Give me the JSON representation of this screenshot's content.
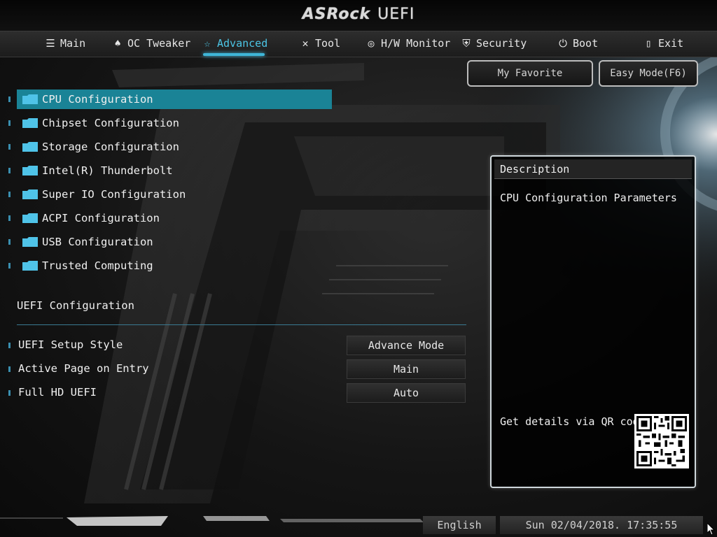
{
  "header": {
    "brand": "ASRock",
    "product": "UEFI"
  },
  "nav": {
    "tabs": [
      {
        "label": "Main",
        "icon": "list-icon"
      },
      {
        "label": "OC Tweaker",
        "icon": "rocket-icon"
      },
      {
        "label": "Advanced",
        "icon": "star-icon",
        "active": true
      },
      {
        "label": "Tool",
        "icon": "tools-icon"
      },
      {
        "label": "H/W Monitor",
        "icon": "monitor-icon"
      },
      {
        "label": "Security",
        "icon": "shield-icon"
      },
      {
        "label": "Boot",
        "icon": "power-icon"
      },
      {
        "label": "Exit",
        "icon": "exit-door-icon"
      }
    ]
  },
  "buttons": {
    "favorite": "My Favorite",
    "easy_mode": "Easy Mode(F6)"
  },
  "menu": {
    "items": [
      {
        "label": "CPU Configuration",
        "selected": true
      },
      {
        "label": "Chipset Configuration"
      },
      {
        "label": "Storage Configuration"
      },
      {
        "label": "Intel(R) Thunderbolt"
      },
      {
        "label": "Super IO Configuration"
      },
      {
        "label": "ACPI Configuration"
      },
      {
        "label": "USB Configuration"
      },
      {
        "label": "Trusted Computing"
      }
    ]
  },
  "uefi_config": {
    "title": "UEFI Configuration",
    "settings": [
      {
        "label": "UEFI Setup Style",
        "value": "Advance Mode"
      },
      {
        "label": "Active Page on Entry",
        "value": "Main"
      },
      {
        "label": "Full HD UEFI",
        "value": "Auto"
      }
    ]
  },
  "description": {
    "title": "Description",
    "text": "CPU Configuration Parameters",
    "qr_label": "Get details via QR code"
  },
  "status": {
    "language": "English",
    "datetime": "Sun 02/04/2018. 17:35:55"
  },
  "colors": {
    "accent": "#3fb6d8",
    "selection": "#1a8396"
  }
}
